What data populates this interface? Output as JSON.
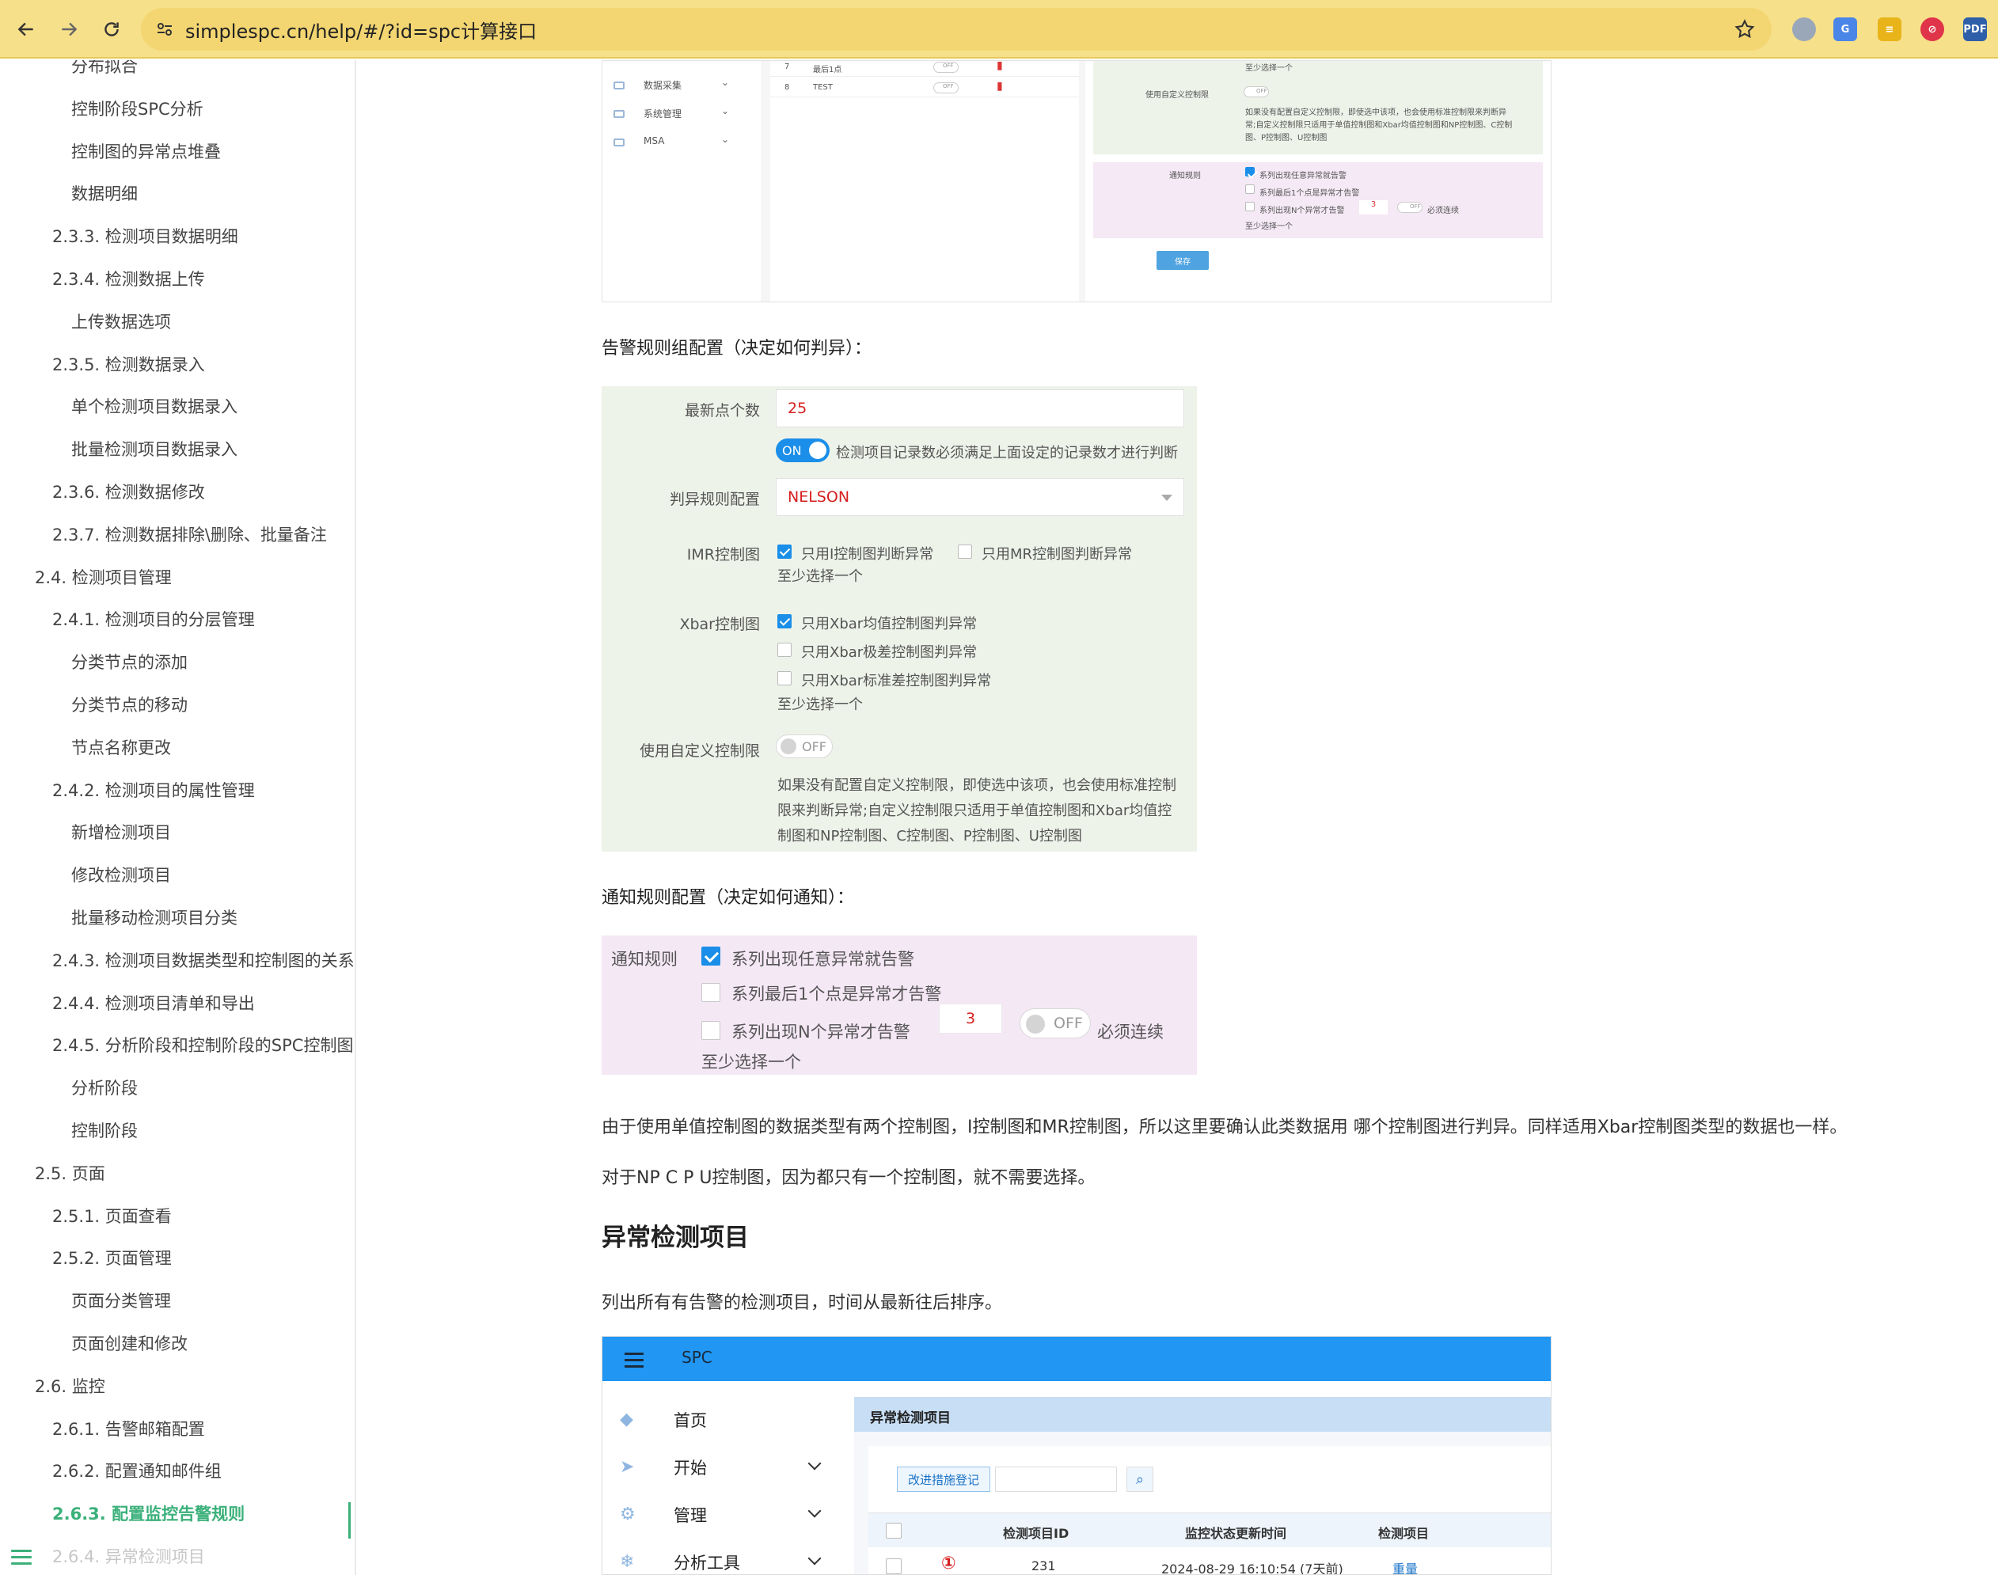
{
  "browser": {
    "url": "simplespc.cn/help/#/?id=spc计算接口"
  },
  "sidebar": {
    "items": [
      {
        "label": "分布拟合",
        "level": 3
      },
      {
        "label": "控制阶段SPC分析",
        "level": 3
      },
      {
        "label": "控制图的异常点堆叠",
        "level": 3
      },
      {
        "label": "数据明细",
        "level": 3
      },
      {
        "label": "2.3.3. 检测项目数据明细",
        "level": 2
      },
      {
        "label": "2.3.4. 检测数据上传",
        "level": 2
      },
      {
        "label": "上传数据选项",
        "level": 3
      },
      {
        "label": "2.3.5. 检测数据录入",
        "level": 2
      },
      {
        "label": "单个检测项目数据录入",
        "level": 3
      },
      {
        "label": "批量检测项目数据录入",
        "level": 3
      },
      {
        "label": "2.3.6. 检测数据修改",
        "level": 2
      },
      {
        "label": "2.3.7. 检测数据排除\\删除、批量备注",
        "level": 2
      },
      {
        "label": "2.4. 检测项目管理",
        "level": 1
      },
      {
        "label": "2.4.1. 检测项目的分层管理",
        "level": 2
      },
      {
        "label": "分类节点的添加",
        "level": 3
      },
      {
        "label": "分类节点的移动",
        "level": 3
      },
      {
        "label": "节点名称更改",
        "level": 3
      },
      {
        "label": "2.4.2. 检测项目的属性管理",
        "level": 2
      },
      {
        "label": "新增检测项目",
        "level": 3
      },
      {
        "label": "修改检测项目",
        "level": 3
      },
      {
        "label": "批量移动检测项目分类",
        "level": 3
      },
      {
        "label": "2.4.3. 检测项目数据类型和控制图的关系",
        "level": 2
      },
      {
        "label": "2.4.4. 检测项目清单和导出",
        "level": 2
      },
      {
        "label": "2.4.5. 分析阶段和控制阶段的SPC控制图",
        "level": 2
      },
      {
        "label": "分析阶段",
        "level": 3
      },
      {
        "label": "控制阶段",
        "level": 3
      },
      {
        "label": "2.5. 页面",
        "level": 1
      },
      {
        "label": "2.5.1. 页面查看",
        "level": 2
      },
      {
        "label": "2.5.2. 页面管理",
        "level": 2
      },
      {
        "label": "页面分类管理",
        "level": 3
      },
      {
        "label": "页面创建和修改",
        "level": 3
      },
      {
        "label": "2.6. 监控",
        "level": 1
      },
      {
        "label": "2.6.1. 告警邮箱配置",
        "level": 2
      },
      {
        "label": "2.6.2. 配置通知邮件组",
        "level": 2
      },
      {
        "label": "2.6.3. 配置监控告警规则",
        "level": 2,
        "active": true
      },
      {
        "label": "2.6.4. 异常检测项目",
        "level": 2,
        "faded": true
      }
    ]
  },
  "shot1": {
    "sidebar": [
      {
        "label": "数据采集"
      },
      {
        "label": "系统管理"
      },
      {
        "label": "MSA"
      }
    ],
    "rows": [
      {
        "num": "7",
        "name": "最后1点",
        "toggle": "OFF"
      },
      {
        "num": "8",
        "name": "TEST",
        "toggle": "OFF"
      }
    ],
    "at_least_one_top": "至少选择一个",
    "custom_limit_label": "使用自定义控制限",
    "custom_limit_toggle": "OFF",
    "custom_limit_desc1": "如果没有配置自定义控制限，即使选中该项，也会使用标准控制限来判断异",
    "custom_limit_desc2": "常;自定义控制限只适用于单值控制图和Xbar均值控制图和NP控制图、C控制",
    "custom_limit_desc3": "图、P控制图、U控制图",
    "notify_label": "通知规则",
    "notify_opt1": "系列出现任意异常就告警",
    "notify_opt2": "系列最后1个点是异常才告警",
    "notify_opt3": "系列出现N个异常才告警",
    "notify_n": "3",
    "notify_toggle": "OFF",
    "notify_consecutive": "必须连续",
    "notify_at_least": "至少选择一个",
    "save": "保存"
  },
  "alarm_heading": "告警规则组配置（决定如何判异）：",
  "alarm_form": {
    "latest_points_label": "最新点个数",
    "latest_points_value": "25",
    "record_toggle": "ON",
    "record_toggle_text": "检测项目记录数必须满足上面设定的记录数才进行判断",
    "rule_label": "判异规则配置",
    "rule_value": "NELSON",
    "imr_label": "IMR控制图",
    "imr_opt1": "只用I控制图判断异常",
    "imr_opt2": "只用MR控制图判断异常",
    "imr_hint": "至少选择一个",
    "xbar_label": "Xbar控制图",
    "xbar_opt1": "只用Xbar均值控制图判异常",
    "xbar_opt2": "只用Xbar极差控制图判异常",
    "xbar_opt3": "只用Xbar标准差控制图判异常",
    "xbar_hint": "至少选择一个",
    "custom_label": "使用自定义控制限",
    "custom_toggle": "OFF",
    "custom_desc1": "如果没有配置自定义控制限，即使选中该项，也会使用标准控制",
    "custom_desc2": "限来判断异常;自定义控制限只适用于单值控制图和Xbar均值控",
    "custom_desc3": "制图和NP控制图、C控制图、P控制图、U控制图"
  },
  "notify_heading": "通知规则配置（决定如何通知）：",
  "notify_form": {
    "label": "通知规则",
    "opt1": "系列出现任意异常就告警",
    "opt2": "系列最后1个点是异常才告警",
    "opt3": "系列出现N个异常才告警",
    "n_value": "3",
    "toggle": "OFF",
    "consecutive": "必须连续",
    "hint": "至少选择一个"
  },
  "para1": "由于使用单值控制图的数据类型有两个控制图，I控制图和MR控制图，所以这里要确认此类数据用 哪个控制图进行判异。同样适用Xbar控制图类型的数据也一样。",
  "para2": "对于NP C P U控制图，因为都只有一个控制图，就不需要选择。",
  "section_title": "异常检测项目",
  "section_desc": "列出所有有告警的检测项目，时间从最新往后排序。",
  "shot2": {
    "app_title": "SPC",
    "nav": [
      {
        "label": "首页",
        "icon": "home-icon"
      },
      {
        "label": "开始",
        "icon": "send-icon"
      },
      {
        "label": "管理",
        "icon": "gear-icon"
      },
      {
        "label": "分析工具",
        "icon": "snowflake-icon"
      }
    ],
    "panel_title": "异常检测项目",
    "action_button": "改进措施登记",
    "columns": [
      "检测项目ID",
      "监控状态更新时间",
      "检测项目"
    ],
    "row": {
      "id": "231",
      "time": "2024-08-29 16:10:54 (7天前)",
      "item": "重量"
    }
  }
}
